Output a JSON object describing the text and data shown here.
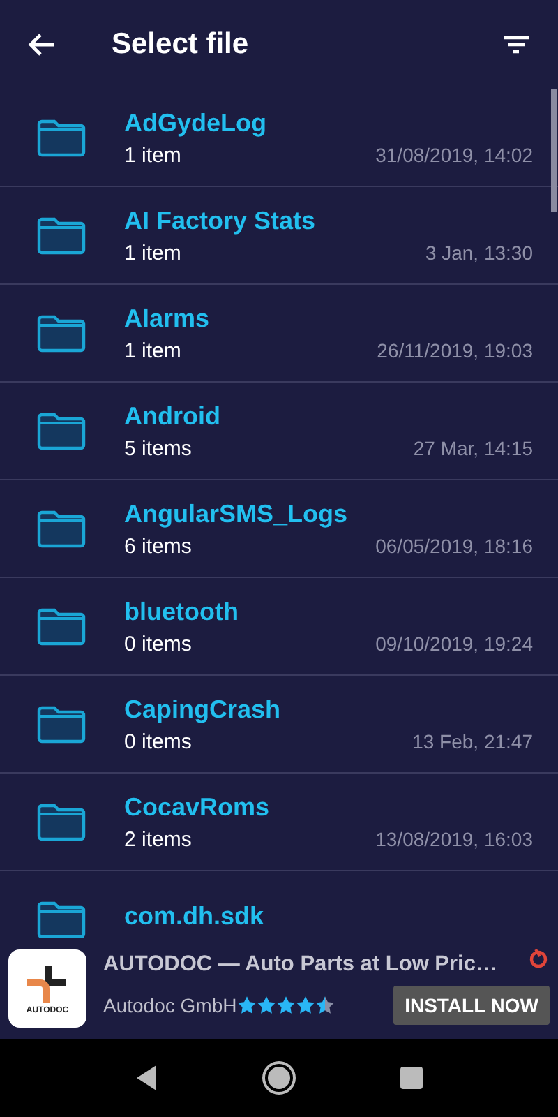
{
  "header": {
    "title": "Select file"
  },
  "files": [
    {
      "name": "AdGydeLog",
      "count": "1 item",
      "modified": "31/08/2019, 14:02"
    },
    {
      "name": "AI Factory Stats",
      "count": "1 item",
      "modified": "3 Jan, 13:30"
    },
    {
      "name": "Alarms",
      "count": "1 item",
      "modified": "26/11/2019, 19:03"
    },
    {
      "name": "Android",
      "count": "5 items",
      "modified": "27 Mar, 14:15"
    },
    {
      "name": "AngularSMS_Logs",
      "count": "6 items",
      "modified": "06/05/2019, 18:16"
    },
    {
      "name": "bluetooth",
      "count": "0 items",
      "modified": "09/10/2019, 19:24"
    },
    {
      "name": "CapingCrash",
      "count": "0 items",
      "modified": "13 Feb, 21:47"
    },
    {
      "name": "CocavRoms",
      "count": "2 items",
      "modified": "13/08/2019, 16:03"
    },
    {
      "name": "com.dh.sdk"
    }
  ],
  "ad": {
    "logo_text": "AUTODOC",
    "title": "AUTODOC — Auto Parts at Low Pric…",
    "publisher": "Autodoc GmbH",
    "stars": 4.5,
    "button": "INSTALL NOW"
  }
}
